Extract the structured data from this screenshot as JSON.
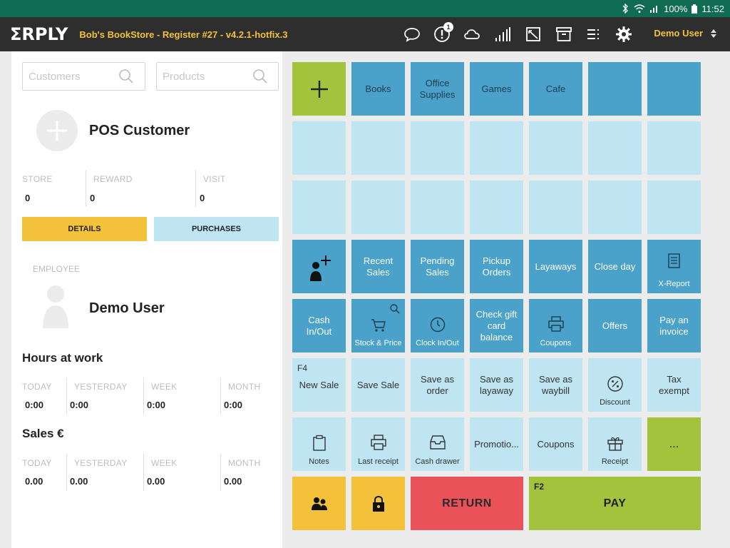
{
  "status": {
    "battery": "100%",
    "time": "11:52"
  },
  "topbar": {
    "logo": "ΣRPLY",
    "title": "Bob's BookStore - Register #27 - v4.2.1-hotfix.3",
    "notification_count": "1",
    "user": "Demo User"
  },
  "search": {
    "customers_placeholder": "Customers",
    "products_placeholder": "Products"
  },
  "customer": {
    "name": "POS Customer",
    "stats": [
      {
        "label": "STORE",
        "value": "0"
      },
      {
        "label": "REWARD",
        "value": "0"
      },
      {
        "label": "VISIT",
        "value": "0"
      }
    ],
    "details_label": "DETAILS",
    "purchases_label": "PURCHASES"
  },
  "employee": {
    "label": "EMPLOYEE",
    "name": "Demo User"
  },
  "hours": {
    "title": "Hours at work",
    "cols": [
      {
        "label": "TODAY",
        "value": "0:00"
      },
      {
        "label": "YESTERDAY",
        "value": "0:00"
      },
      {
        "label": "WEEK",
        "value": "0:00"
      },
      {
        "label": "MONTH",
        "value": "0:00"
      }
    ]
  },
  "sales": {
    "title": "Sales €",
    "cols": [
      {
        "label": "TODAY",
        "value": "0.00"
      },
      {
        "label": "YESTERDAY",
        "value": "0.00"
      },
      {
        "label": "WEEK",
        "value": "0.00"
      },
      {
        "label": "MONTH",
        "value": "0.00"
      }
    ]
  },
  "grid": {
    "row1": [
      "Books",
      "Office Supplies",
      "Games",
      "Cafe"
    ],
    "row4": [
      "Recent Sales",
      "Pending Sales",
      "Pickup Orders",
      "Layaways",
      "Close day",
      "X-Report"
    ],
    "row5": [
      "Cash In/Out",
      "Stock & Price",
      "Clock In/Out",
      "Check gift card balance",
      "Coupons",
      "Offers",
      "Pay an invoice"
    ],
    "row6": {
      "new_sale_key": "F4",
      "labels": [
        "New Sale",
        "Save Sale",
        "Save as order",
        "Save as layaway",
        "Save as waybill",
        "Discount",
        "Tax exempt"
      ]
    },
    "row7": [
      "Notes",
      "Last receipt",
      "Cash drawer",
      "Promotio...",
      "Coupons",
      "Receipt",
      "..."
    ],
    "row8": {
      "return_label": "RETURN",
      "pay_key": "F2",
      "pay_label": "PAY"
    }
  },
  "colors": {
    "dark_tile": "#4aa1c9",
    "light_tile": "#bfe5f3",
    "green": "#a3c33c",
    "yellow": "#f3c13a",
    "red": "#ea5259",
    "topbar": "#2e2e2e",
    "statusbar": "#0f6b52"
  }
}
